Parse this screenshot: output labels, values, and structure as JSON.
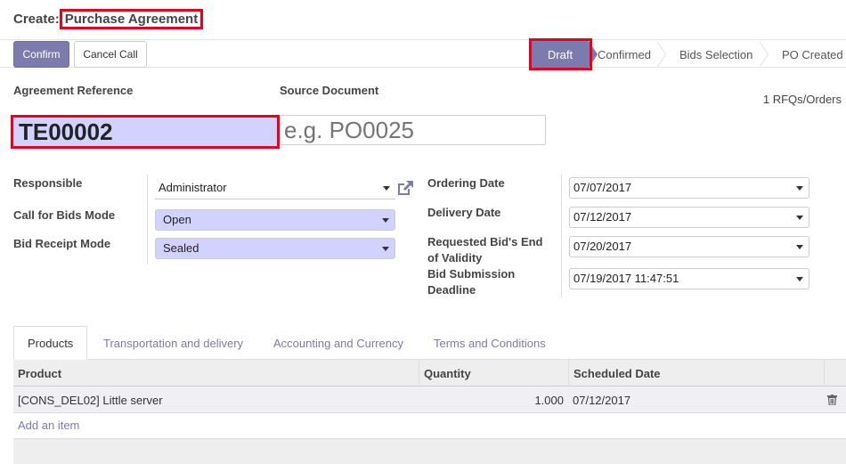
{
  "breadcrumb": {
    "prefix": "Create:",
    "current": "Purchase Agreement"
  },
  "buttons": {
    "confirm": "Confirm",
    "cancel_call": "Cancel Call"
  },
  "statusbar": [
    "Draft",
    "Confirmed",
    "Bids Selection",
    "PO Created"
  ],
  "fields": {
    "agreement_reference_label": "Agreement Reference",
    "agreement_reference_value": "TE00002",
    "source_document_label": "Source Document",
    "source_document_placeholder": "e.g. PO0025",
    "rfq_button": "1 RFQs/Orders",
    "responsible_label": "Responsible",
    "responsible_value": "Administrator",
    "call_for_bids_label": "Call for Bids Mode",
    "call_for_bids_value": "Open",
    "bid_receipt_label": "Bid Receipt Mode",
    "bid_receipt_value": "Sealed",
    "ordering_date_label": "Ordering Date",
    "ordering_date_value": "07/07/2017",
    "delivery_date_label": "Delivery Date",
    "delivery_date_value": "07/12/2017",
    "requested_end_label_1": "Requested Bid's End",
    "requested_end_label_2": "of Validity",
    "requested_end_value": "07/20/2017",
    "submission_label_1": "Bid Submission",
    "submission_label_2": "Deadline",
    "submission_value": "07/19/2017 11:47:51"
  },
  "tabs": [
    "Products",
    "Transportation and delivery",
    "Accounting and Currency",
    "Terms and Conditions"
  ],
  "table": {
    "headers": [
      "Product",
      "Quantity",
      "Scheduled Date"
    ],
    "rows": [
      {
        "product": "[CONS_DEL02] Little server",
        "quantity": "1.000",
        "scheduled_date": "07/12/2017"
      }
    ],
    "add_item": "Add an item"
  },
  "colors": {
    "accent": "#7c7bad",
    "required_bg": "#d2d2ff",
    "highlight_border": "#e8001c"
  }
}
